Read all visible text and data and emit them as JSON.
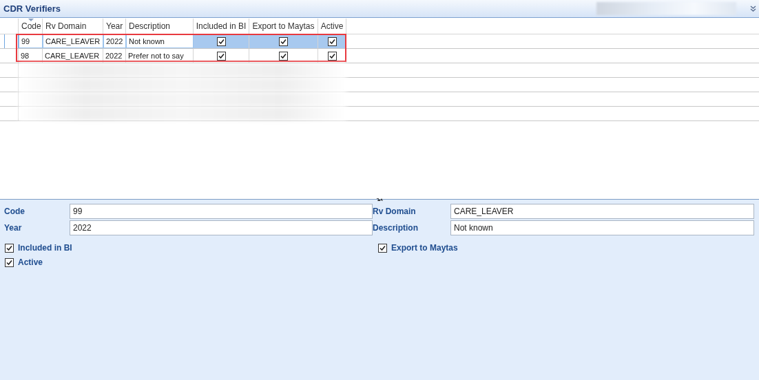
{
  "window": {
    "title": "CDR Verifiers"
  },
  "table": {
    "columns": [
      "Code",
      "Rv Domain",
      "Year",
      "Description",
      "Included in BI",
      "Export to Maytas",
      "Active"
    ],
    "rows": [
      {
        "code": "99",
        "rv_domain": "CARE_LEAVER",
        "year": "2022",
        "description": "Not known",
        "included_in_bi": true,
        "export_to_maytas": true,
        "active": true,
        "selected": true
      },
      {
        "code": "98",
        "rv_domain": "CARE_LEAVER",
        "year": "2022",
        "description": "Prefer not to say",
        "included_in_bi": true,
        "export_to_maytas": true,
        "active": true,
        "selected": false
      }
    ],
    "highlighted_rows": true
  },
  "form": {
    "fields": [
      {
        "label": "Code",
        "value": "99"
      },
      {
        "label": "Rv Domain",
        "value": "CARE_LEAVER"
      },
      {
        "label": "Year",
        "value": "2022"
      },
      {
        "label": "Description",
        "value": "Not known"
      }
    ],
    "checkboxes": [
      {
        "label": "Included in BI",
        "checked": true
      },
      {
        "label": "Export to Maytas",
        "checked": true
      },
      {
        "label": "Active",
        "checked": true
      }
    ]
  }
}
